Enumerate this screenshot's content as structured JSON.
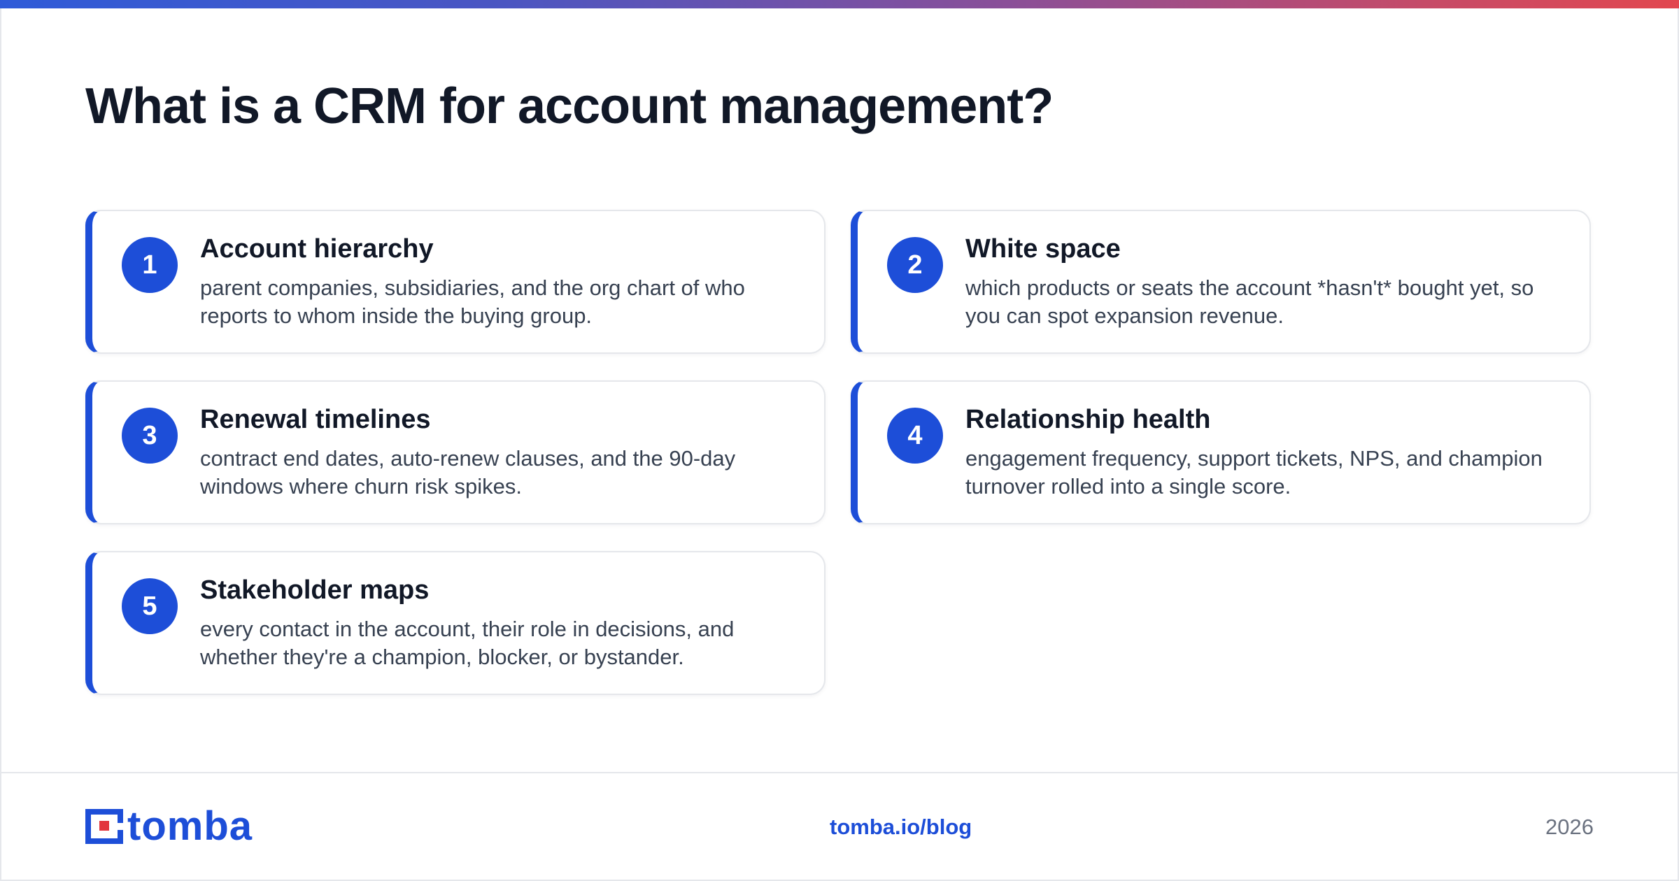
{
  "title": "What is a CRM for account management?",
  "cards": [
    {
      "number": "1",
      "title": "Account hierarchy",
      "description": "parent companies, subsidiaries, and the org chart of who reports to whom inside the buying group."
    },
    {
      "number": "2",
      "title": "White space",
      "description": "which products or seats the account *hasn't* bought yet, so you can spot expansion revenue."
    },
    {
      "number": "3",
      "title": "Renewal timelines",
      "description": "contract end dates, auto-renew clauses, and the 90-day windows where churn risk spikes."
    },
    {
      "number": "4",
      "title": "Relationship health",
      "description": "engagement frequency, support tickets, NPS, and champion turnover rolled into a single score."
    },
    {
      "number": "5",
      "title": "Stakeholder maps",
      "description": "every contact in the account, their role in decisions, and whether they're a champion, blocker, or bystander."
    }
  ],
  "footer": {
    "logo_text": "tomba",
    "link": "tomba.io/blog",
    "year": "2026"
  },
  "colors": {
    "accent": "#1d4ed8",
    "logo_red": "#e2343c",
    "title": "#111827",
    "body_text": "#374151",
    "muted": "#6b7280"
  }
}
